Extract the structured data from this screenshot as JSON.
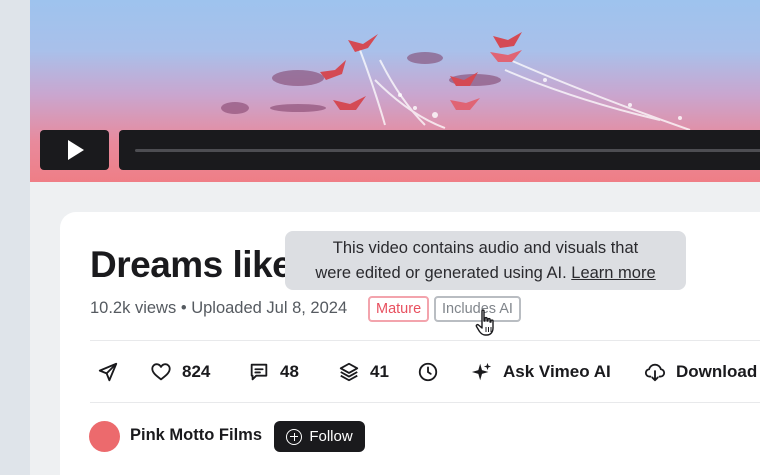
{
  "video": {
    "title": "Dreams like",
    "views": "10.2k views",
    "separator": "•",
    "uploaded": "Uploaded Jul 8, 2024",
    "badges": {
      "mature": "Mature",
      "ai": "Includes AI"
    },
    "tooltip": {
      "line1": "This video contains audio and visuals that",
      "line2": "were edited or generated using AI.",
      "link": "Learn more"
    }
  },
  "actions": {
    "share_icon": "paper-plane-icon",
    "likes": "824",
    "comments": "48",
    "collections": "41",
    "watch_later_icon": "clock-icon",
    "ask_ai": "Ask Vimeo AI",
    "download": "Download"
  },
  "channel": {
    "name": "Pink Motto Films",
    "follow_label": "Follow",
    "avatar_color": "#ec6a6d"
  },
  "colors": {
    "mature": "#e8505f",
    "player_bg": "#1a1a1d",
    "sky": "#9ec3ee",
    "water": "#ef7e86"
  }
}
